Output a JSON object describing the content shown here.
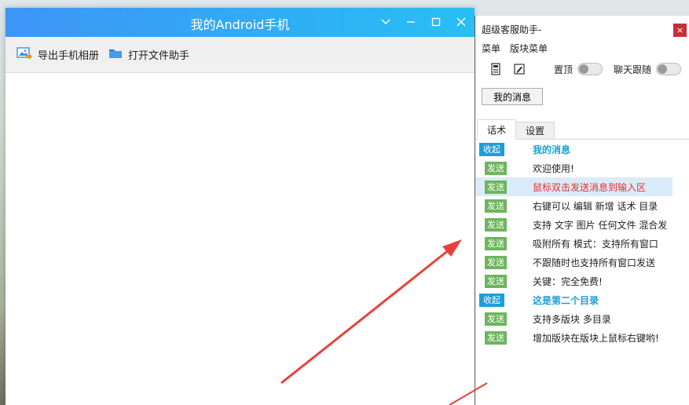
{
  "phone_window": {
    "title": "我的Android手机",
    "controls": [
      "chevron-down",
      "minimize",
      "maximize",
      "close"
    ],
    "toolbar": [
      {
        "label": "导出手机相册",
        "icon": "photo-export-icon"
      },
      {
        "label": "打开文件助手",
        "icon": "folder-icon"
      }
    ]
  },
  "helper_window": {
    "title": "超级客服助手-",
    "close_label": "×",
    "menu": [
      "菜单",
      "版块菜单"
    ],
    "toolbar": {
      "pin_label": "置顶",
      "follow_label": "聊天跟随",
      "pin_on": false,
      "follow_on": false
    },
    "my_messages_button": "我的消息",
    "tabs": [
      "话术",
      "设置"
    ],
    "messages": [
      {
        "badge": "收起",
        "kind": "collapse",
        "text": "我的消息",
        "style": "heading"
      },
      {
        "badge": "发送",
        "kind": "send",
        "text": "欢迎使用!",
        "style": "normal"
      },
      {
        "badge": "发送",
        "kind": "send",
        "text": "鼠标双击发送消息到输入区",
        "style": "red"
      },
      {
        "badge": "发送",
        "kind": "send",
        "text": "右键可以 编辑 新增 话术 目录",
        "style": "normal"
      },
      {
        "badge": "发送",
        "kind": "send",
        "text": "支持 文字 图片 任何文件 混合发",
        "style": "normal"
      },
      {
        "badge": "发送",
        "kind": "send",
        "text": "吸附所有 模式：支持所有窗口",
        "style": "normal"
      },
      {
        "badge": "发送",
        "kind": "send",
        "text": "不跟随时也支持所有窗口发送",
        "style": "normal"
      },
      {
        "badge": "发送",
        "kind": "send",
        "text": "关键：完全免费!",
        "style": "normal"
      },
      {
        "badge": "收起",
        "kind": "collapse",
        "text": "这是第二个目录",
        "style": "heading"
      },
      {
        "badge": "发送",
        "kind": "send",
        "text": "支持多版块 多目录",
        "style": "normal"
      },
      {
        "badge": "发送",
        "kind": "send",
        "text": "增加版块在版块上鼠标右键哟!",
        "style": "normal"
      }
    ]
  },
  "colors": {
    "title_gradient_start": "#3d95f7",
    "title_gradient_end": "#27bff4",
    "collapse_badge": "#1e9ed8",
    "send_badge": "#6cb55d",
    "highlight_row": "#dcebf8",
    "red_text": "#e03030",
    "arrow": "#e8413c"
  }
}
